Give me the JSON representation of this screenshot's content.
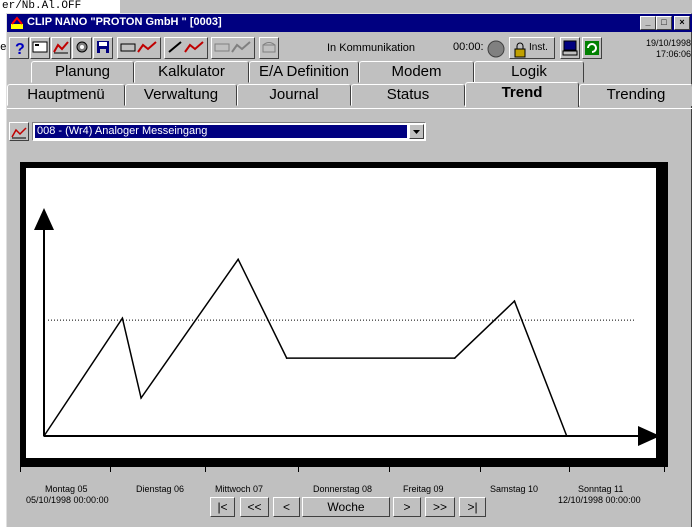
{
  "background_window": {
    "line1": "er/Nb.Al.OFF",
    "fragment": "et"
  },
  "window": {
    "title": "CLIP NANO \"PROTON GmbH    \" [0003]",
    "title_color": "#000080"
  },
  "toolbar": {
    "status_text": "In Kommunikation",
    "timer": "00:00:",
    "inst_label": "Inst.",
    "date": "19/10/1998",
    "time": "17:06:06"
  },
  "tabs_top": [
    {
      "label": "Planung"
    },
    {
      "label": "Kalkulator"
    },
    {
      "label": "E/A Definition"
    },
    {
      "label": "Modem"
    },
    {
      "label": "Logik"
    }
  ],
  "tabs_bottom": [
    {
      "label": "Hauptmenü"
    },
    {
      "label": "Verwaltung"
    },
    {
      "label": "Journal"
    },
    {
      "label": "Status"
    },
    {
      "label": "Trend",
      "active": true
    },
    {
      "label": "Trending"
    }
  ],
  "channel_select": {
    "value": "008 - (Wr4) Analoger Messeingang"
  },
  "chart_data": {
    "type": "line",
    "title": "",
    "xlabel": "",
    "ylabel": "",
    "x": [
      0,
      1.05,
      1.3,
      2.6,
      3.25,
      5.5,
      6.3,
      7.0,
      7.7
    ],
    "values": [
      0.0,
      0.62,
      0.2,
      0.93,
      0.41,
      0.41,
      0.71,
      0.0,
      0.0
    ],
    "reference_line": 0.61,
    "days": [
      "Montag 05",
      "Dienstag 06",
      "Mittwoch 07",
      "Donnerstag 08",
      "Freitag 09",
      "Samstag 10",
      "Sonntag 11"
    ],
    "range_start": "05/10/1998 00:00:00",
    "range_end": "12/10/1998 00:00:00"
  },
  "nav": {
    "first": "|<",
    "prev_fast": "<<",
    "prev": "<",
    "period": "Woche",
    "next": ">",
    "next_fast": ">>",
    "last": ">|"
  }
}
